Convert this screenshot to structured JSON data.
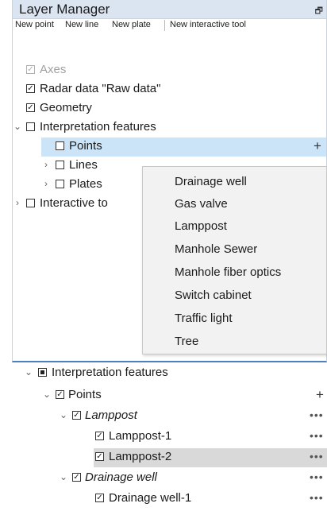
{
  "panel": {
    "title": "Layer Manager",
    "dock_icon": "restore-icon",
    "toolbar": [
      "New point",
      "New line",
      "New plate",
      "New interactive tool"
    ]
  },
  "tree": [
    {
      "label": "Axes",
      "state": "checked",
      "disabled": true
    },
    {
      "label": "Radar data \"Raw data\"",
      "state": "checked"
    },
    {
      "label": "Geometry",
      "state": "checked"
    },
    {
      "label": "Interpretation features",
      "state": "unchecked",
      "expanded": true
    },
    {
      "label": "Points",
      "state": "unchecked",
      "selected": true,
      "action": "+"
    },
    {
      "label": "Lines",
      "state": "unchecked",
      "collapsed": true
    },
    {
      "label": "Plates",
      "state": "unchecked",
      "collapsed": true
    },
    {
      "label": "Interactive to",
      "state": "unchecked",
      "collapsed": true
    }
  ],
  "context_menu": {
    "items": [
      "Drainage well",
      "Gas valve",
      "Lamppost",
      "Manhole Sewer",
      "Manhole fiber optics",
      "Switch cabinet",
      "Traffic light",
      "Tree"
    ]
  },
  "tree2": [
    {
      "label": "Interpretation features",
      "state": "partial",
      "expanded": true
    },
    {
      "label": "Points",
      "state": "checked",
      "expanded": true,
      "action": "+"
    },
    {
      "label": "Lamppost",
      "state": "checked",
      "expanded": true,
      "italic": true,
      "action": "•••"
    },
    {
      "label": "Lamppost-1",
      "state": "checked",
      "action": "•••"
    },
    {
      "label": "Lamppost-2",
      "state": "checked",
      "selected": true,
      "action": "•••"
    },
    {
      "label": "Drainage well",
      "state": "checked",
      "expanded": true,
      "italic": true,
      "action": "•••"
    },
    {
      "label": "Drainage well-1",
      "state": "checked",
      "action": "•••"
    }
  ],
  "colors": {
    "titlebar": "#dbe5f1",
    "selection": "#cce4f7",
    "panel_border": "#4a7fc0"
  }
}
